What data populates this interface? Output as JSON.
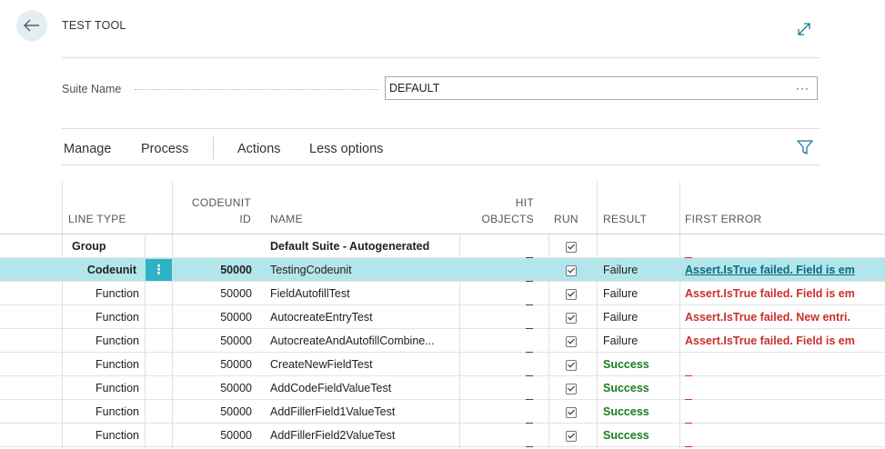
{
  "header": {
    "title": "TEST TOOL",
    "back_icon": "arrow-left-icon",
    "expand_icon": "expand-diagonal-icon"
  },
  "suite": {
    "label": "Suite Name",
    "value": "DEFAULT",
    "lookup": "···"
  },
  "actions": {
    "items": [
      "Manage",
      "Process",
      "Actions",
      "Less options"
    ],
    "filter_icon": "filter-funnel-icon"
  },
  "columns": {
    "line_type": "LINE TYPE",
    "codeunit_id_1": "CODEUNIT",
    "codeunit_id_2": "ID",
    "name": "NAME",
    "hit_objects_1": "HIT",
    "hit_objects_2": "OBJECTS",
    "run": "RUN",
    "result": "RESULT",
    "first_error": "FIRST ERROR"
  },
  "rows": [
    {
      "line_type": "Group",
      "codeunit_id": "",
      "name": "Default Suite - Autogenerated",
      "run": true,
      "result": "",
      "first_error": ""
    },
    {
      "line_type": "Codeunit",
      "codeunit_id": "50000",
      "name": "TestingCodeunit",
      "run": true,
      "result": "Failure",
      "first_error": "Assert.IsTrue failed. Field is em"
    },
    {
      "line_type": "Function",
      "codeunit_id": "50000",
      "name": "FieldAutofillTest",
      "run": true,
      "result": "Failure",
      "first_error": "Assert.IsTrue failed. Field is em"
    },
    {
      "line_type": "Function",
      "codeunit_id": "50000",
      "name": "AutocreateEntryTest",
      "run": true,
      "result": "Failure",
      "first_error": "Assert.IsTrue failed. New entri."
    },
    {
      "line_type": "Function",
      "codeunit_id": "50000",
      "name": "AutocreateAndAutofillCombine...",
      "run": true,
      "result": "Failure",
      "first_error": "Assert.IsTrue failed. Field is em"
    },
    {
      "line_type": "Function",
      "codeunit_id": "50000",
      "name": "CreateNewFieldTest",
      "run": true,
      "result": "Success",
      "first_error": ""
    },
    {
      "line_type": "Function",
      "codeunit_id": "50000",
      "name": "AddCodeFieldValueTest",
      "run": true,
      "result": "Success",
      "first_error": ""
    },
    {
      "line_type": "Function",
      "codeunit_id": "50000",
      "name": "AddFillerField1ValueTest",
      "run": true,
      "result": "Success",
      "first_error": ""
    },
    {
      "line_type": "Function",
      "codeunit_id": "50000",
      "name": "AddFillerField2ValueTest",
      "run": true,
      "result": "Success",
      "first_error": ""
    }
  ],
  "row_menu": "⋮",
  "colors": {
    "accent": "#2db3c6",
    "selected_row": "#b3e6ea",
    "success": "#1a7d1a",
    "error": "#c8302a",
    "link": "#0b6b83"
  }
}
